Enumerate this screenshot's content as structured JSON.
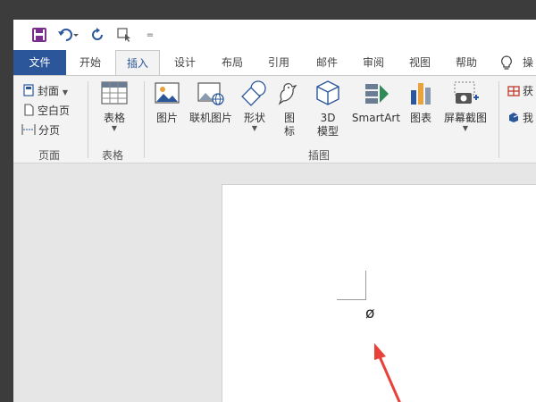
{
  "qat": {
    "customize_label": "="
  },
  "tabs": {
    "file": "文件",
    "home": "开始",
    "insert": "插入",
    "design": "设计",
    "layout": "布局",
    "references": "引用",
    "mailings": "邮件",
    "review": "审阅",
    "view": "视图",
    "help": "帮助",
    "tell_me_truncated": "操"
  },
  "ribbon": {
    "pages": {
      "cover": "封面",
      "blank": "空白页",
      "break": "分页",
      "group_label": "页面"
    },
    "tables": {
      "table": "表格",
      "group_label": "表格"
    },
    "illustrations": {
      "pictures": "图片",
      "online_pictures": "联机图片",
      "shapes": "形状",
      "icons_line1": "图",
      "icons_line2": "标",
      "model_line1": "3D",
      "model_line2": "模型",
      "smartart": "SmartArt",
      "chart": "图表",
      "screenshot": "屏幕截图",
      "group_label": "插图"
    },
    "addins": {
      "get_truncated": "获",
      "my_truncated": "我"
    }
  },
  "document": {
    "character": "ø"
  },
  "colors": {
    "accent": "#2b579a",
    "arrow": "#e8413a"
  }
}
